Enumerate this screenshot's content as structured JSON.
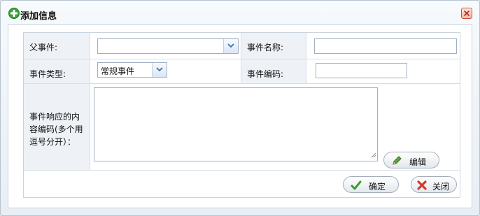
{
  "dialog": {
    "title": "添加信息",
    "icon": "plus-icon",
    "close_icon": "close-icon"
  },
  "form": {
    "parent_event_label": "父事件:",
    "parent_event_value": "",
    "event_name_label": "事件名称:",
    "event_name_value": "",
    "event_type_label": "事件类型:",
    "event_type_value": "常规事件",
    "event_code_label": "事件编码:",
    "event_code_value": "",
    "response_code_label": "事件响应的内容编码(多个用逗号分开）：",
    "response_code_value": "",
    "edit_button": "编辑"
  },
  "footer": {
    "ok_button": "确定",
    "close_button": "关闭"
  },
  "colors": {
    "label_bg": "#eef2f7",
    "border": "#c9d4df",
    "ok_green": "#3c9a2f",
    "close_red": "#d43a2a"
  }
}
